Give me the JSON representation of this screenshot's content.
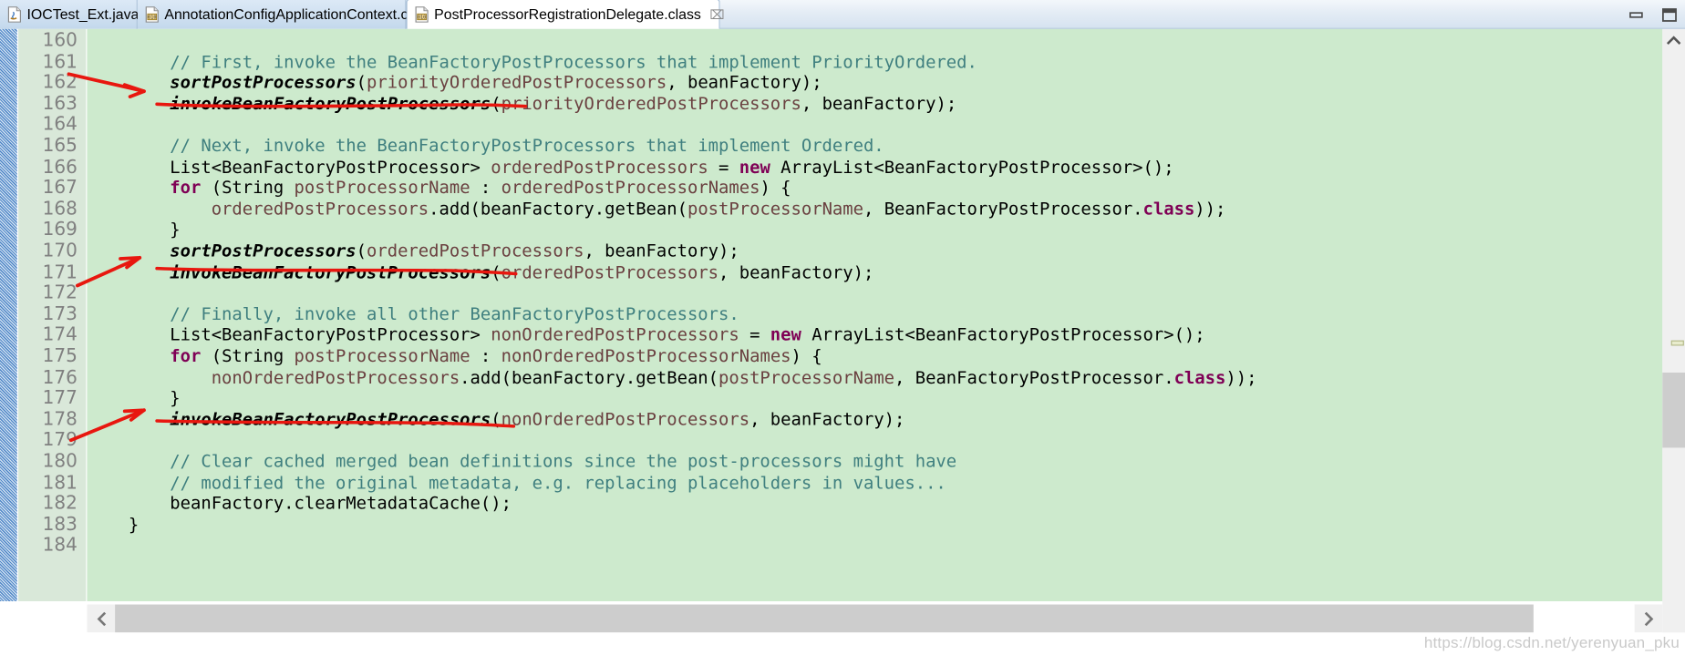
{
  "window": {
    "minimize_label": "Minimize",
    "maximize_label": "Maximize"
  },
  "tabs": [
    {
      "label": "IOCTest_Ext.java",
      "icon": "java-file-icon",
      "active": false,
      "closable": false
    },
    {
      "label": "AnnotationConfigApplicationContext.class",
      "icon": "class-file-icon",
      "active": false,
      "closable": false
    },
    {
      "label": "PostProcessorRegistrationDelegate.class",
      "icon": "class-file-icon",
      "active": true,
      "closable": true,
      "close_glyph": "⌧"
    }
  ],
  "editor": {
    "first_line": 160,
    "line_numbers": [
      160,
      161,
      162,
      163,
      164,
      165,
      166,
      167,
      168,
      169,
      170,
      171,
      172,
      173,
      174,
      175,
      176,
      177,
      178,
      179,
      180,
      181,
      182,
      183,
      184
    ],
    "lines": [
      {
        "n": 160,
        "tokens": []
      },
      {
        "n": 161,
        "tokens": [
          {
            "t": "cm",
            "s": "        // First, invoke the BeanFactoryPostProcessors that implement PriorityOrdered."
          }
        ]
      },
      {
        "n": 162,
        "tokens": [
          {
            "t": "pl",
            "s": "        "
          },
          {
            "t": "mth",
            "s": "sortPostProcessors"
          },
          {
            "t": "pl",
            "s": "("
          },
          {
            "t": "fld",
            "s": "priorityOrderedPostProcessors"
          },
          {
            "t": "pl",
            "s": ", beanFactory);"
          }
        ]
      },
      {
        "n": 163,
        "tokens": [
          {
            "t": "pl",
            "s": "        "
          },
          {
            "t": "mth",
            "s": "invokeBeanFactoryPostProcessors"
          },
          {
            "t": "pl",
            "s": "("
          },
          {
            "t": "fld",
            "s": "priorityOrderedPostProcessors"
          },
          {
            "t": "pl",
            "s": ", beanFactory);"
          }
        ]
      },
      {
        "n": 164,
        "tokens": []
      },
      {
        "n": 165,
        "tokens": [
          {
            "t": "cm",
            "s": "        // Next, invoke the BeanFactoryPostProcessors that implement Ordered."
          }
        ]
      },
      {
        "n": 166,
        "tokens": [
          {
            "t": "pl",
            "s": "        List<BeanFactoryPostProcessor> "
          },
          {
            "t": "fld",
            "s": "orderedPostProcessors"
          },
          {
            "t": "pl",
            "s": " = "
          },
          {
            "t": "kw",
            "s": "new"
          },
          {
            "t": "pl",
            "s": " ArrayList<BeanFactoryPostProcessor>();"
          }
        ]
      },
      {
        "n": 167,
        "tokens": [
          {
            "t": "pl",
            "s": "        "
          },
          {
            "t": "kw",
            "s": "for"
          },
          {
            "t": "pl",
            "s": " (String "
          },
          {
            "t": "fld",
            "s": "postProcessorName"
          },
          {
            "t": "pl",
            "s": " : "
          },
          {
            "t": "fld",
            "s": "orderedPostProcessorNames"
          },
          {
            "t": "pl",
            "s": ") {"
          }
        ]
      },
      {
        "n": 168,
        "tokens": [
          {
            "t": "pl",
            "s": "            "
          },
          {
            "t": "fld",
            "s": "orderedPostProcessors"
          },
          {
            "t": "pl",
            "s": ".add(beanFactory.getBean("
          },
          {
            "t": "fld",
            "s": "postProcessorName"
          },
          {
            "t": "pl",
            "s": ", BeanFactoryPostProcessor."
          },
          {
            "t": "kw",
            "s": "class"
          },
          {
            "t": "pl",
            "s": "));"
          }
        ]
      },
      {
        "n": 169,
        "tokens": [
          {
            "t": "pl",
            "s": "        }"
          }
        ]
      },
      {
        "n": 170,
        "tokens": [
          {
            "t": "pl",
            "s": "        "
          },
          {
            "t": "mth",
            "s": "sortPostProcessors"
          },
          {
            "t": "pl",
            "s": "("
          },
          {
            "t": "fld",
            "s": "orderedPostProcessors"
          },
          {
            "t": "pl",
            "s": ", beanFactory);"
          }
        ]
      },
      {
        "n": 171,
        "tokens": [
          {
            "t": "pl",
            "s": "        "
          },
          {
            "t": "mth",
            "s": "invokeBeanFactoryPostProcessors"
          },
          {
            "t": "pl",
            "s": "("
          },
          {
            "t": "fld",
            "s": "orderedPostProcessors"
          },
          {
            "t": "pl",
            "s": ", beanFactory);"
          }
        ]
      },
      {
        "n": 172,
        "tokens": []
      },
      {
        "n": 173,
        "tokens": [
          {
            "t": "cm",
            "s": "        // Finally, invoke all other BeanFactoryPostProcessors."
          }
        ]
      },
      {
        "n": 174,
        "tokens": [
          {
            "t": "pl",
            "s": "        List<BeanFactoryPostProcessor> "
          },
          {
            "t": "fld",
            "s": "nonOrderedPostProcessors"
          },
          {
            "t": "pl",
            "s": " = "
          },
          {
            "t": "kw",
            "s": "new"
          },
          {
            "t": "pl",
            "s": " ArrayList<BeanFactoryPostProcessor>();"
          }
        ]
      },
      {
        "n": 175,
        "tokens": [
          {
            "t": "pl",
            "s": "        "
          },
          {
            "t": "kw",
            "s": "for"
          },
          {
            "t": "pl",
            "s": " (String "
          },
          {
            "t": "fld",
            "s": "postProcessorName"
          },
          {
            "t": "pl",
            "s": " : "
          },
          {
            "t": "fld",
            "s": "nonOrderedPostProcessorNames"
          },
          {
            "t": "pl",
            "s": ") {"
          }
        ]
      },
      {
        "n": 176,
        "tokens": [
          {
            "t": "pl",
            "s": "            "
          },
          {
            "t": "fld",
            "s": "nonOrderedPostProcessors"
          },
          {
            "t": "pl",
            "s": ".add(beanFactory.getBean("
          },
          {
            "t": "fld",
            "s": "postProcessorName"
          },
          {
            "t": "pl",
            "s": ", BeanFactoryPostProcessor."
          },
          {
            "t": "kw",
            "s": "class"
          },
          {
            "t": "pl",
            "s": "));"
          }
        ]
      },
      {
        "n": 177,
        "tokens": [
          {
            "t": "pl",
            "s": "        }"
          }
        ]
      },
      {
        "n": 178,
        "tokens": [
          {
            "t": "pl",
            "s": "        "
          },
          {
            "t": "mth",
            "s": "invokeBeanFactoryPostProcessors"
          },
          {
            "t": "pl",
            "s": "("
          },
          {
            "t": "fld",
            "s": "nonOrderedPostProcessors"
          },
          {
            "t": "pl",
            "s": ", beanFactory);"
          }
        ]
      },
      {
        "n": 179,
        "tokens": []
      },
      {
        "n": 180,
        "tokens": [
          {
            "t": "cm",
            "s": "        // Clear cached merged bean definitions since the post-processors might have"
          }
        ]
      },
      {
        "n": 181,
        "tokens": [
          {
            "t": "cm",
            "s": "        // modified the original metadata, e.g. replacing placeholders in values..."
          }
        ]
      },
      {
        "n": 182,
        "tokens": [
          {
            "t": "pl",
            "s": "        beanFactory.clearMetadataCache();"
          }
        ]
      },
      {
        "n": 183,
        "tokens": [
          {
            "t": "pl",
            "s": "    }"
          }
        ]
      },
      {
        "n": 184,
        "tokens": []
      }
    ]
  },
  "annotations": {
    "pen_color": "#e8170f",
    "marks": [
      {
        "kind": "arrow",
        "label": "arrow-to-line-163"
      },
      {
        "kind": "underline",
        "label": "underline-line-163"
      },
      {
        "kind": "arrow",
        "label": "arrow-to-line-171"
      },
      {
        "kind": "underline",
        "label": "underline-line-171"
      },
      {
        "kind": "arrow",
        "label": "arrow-to-line-178"
      },
      {
        "kind": "underline",
        "label": "underline-line-178"
      }
    ]
  },
  "scrollbars": {
    "vertical": {
      "up_glyph": "⌃",
      "down_glyph": "⌄"
    },
    "horizontal": {
      "left_glyph": "‹",
      "right_glyph": "›"
    }
  },
  "watermark": {
    "text": "https://blog.csdn.net/yerenyuan_pku"
  },
  "colors": {
    "editor_bg": "#cdeacd",
    "gutter_bg": "#d9e8d9",
    "comment": "#3f7f7f",
    "keyword": "#7f0055",
    "field": "#6a4040",
    "plain": "#000000",
    "pen": "#e8170f"
  }
}
